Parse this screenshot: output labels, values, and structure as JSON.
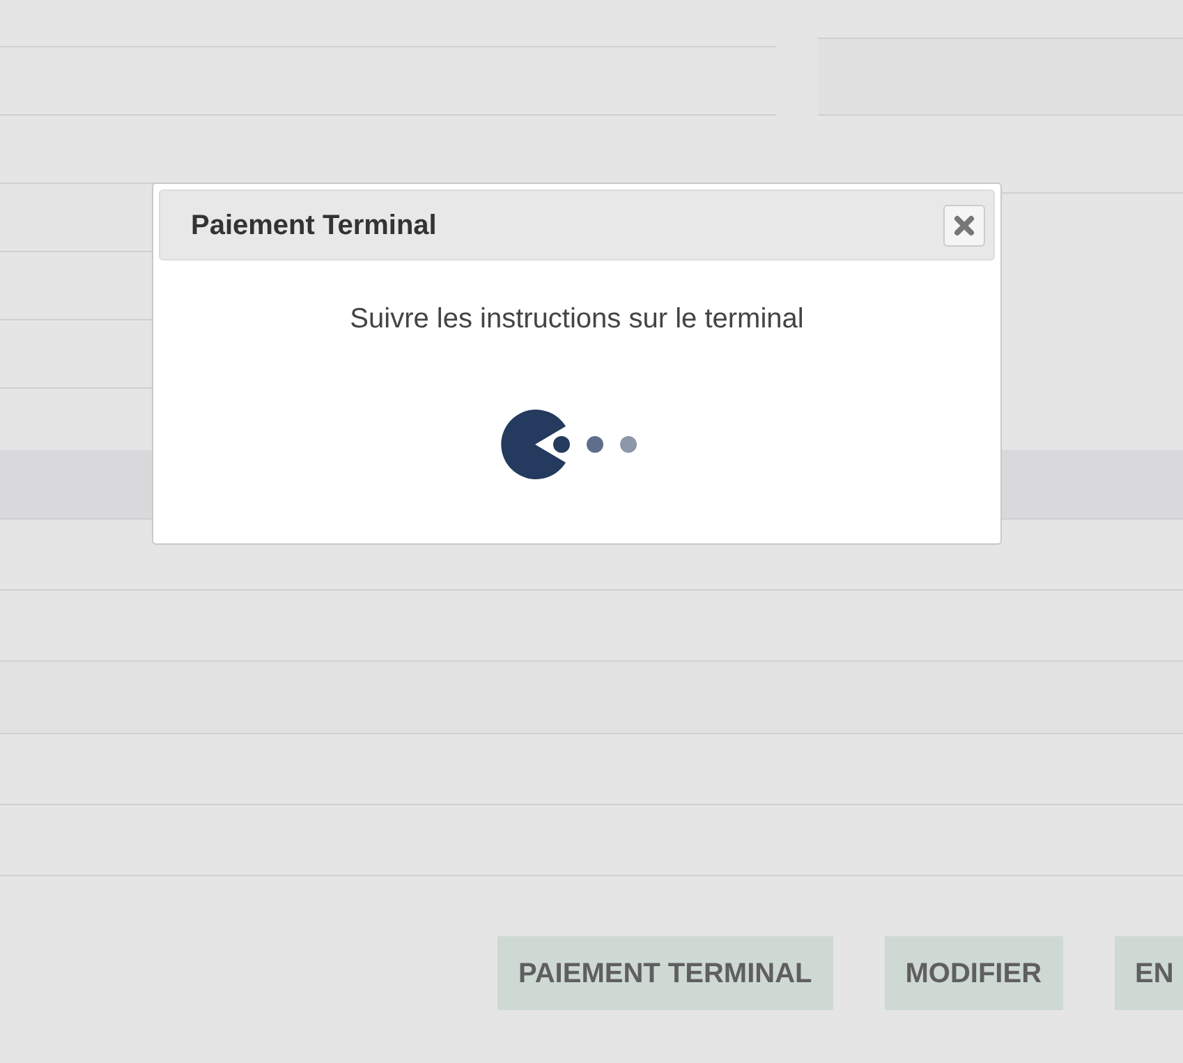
{
  "dialog": {
    "title": "Paiement Terminal",
    "message": "Suivre les instructions sur le terminal"
  },
  "buttons": [
    "PAIEMENT TERMINAL",
    "MODIFIER",
    "EN"
  ]
}
